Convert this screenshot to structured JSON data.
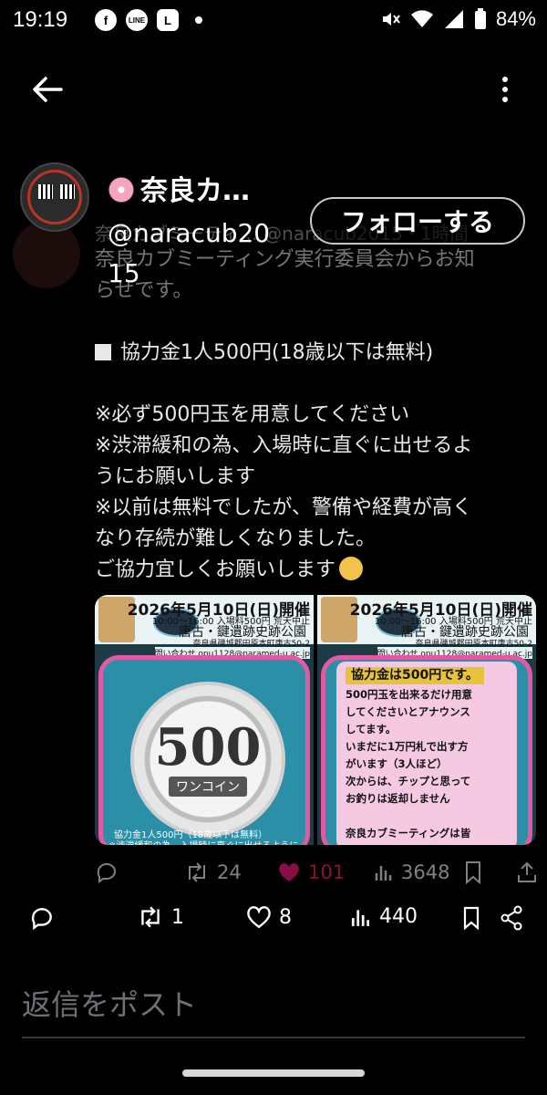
{
  "status_bar": {
    "time": "19:19",
    "battery": "84%",
    "app_icons": [
      "facebook-icon",
      "line-icon",
      "l-app-icon",
      "notification-dot"
    ],
    "icons": [
      "mute-icon",
      "wifi-icon",
      "signal-icon",
      "battery-icon"
    ],
    "line_label": "LINE",
    "l_label": "L",
    "fb_label": "f"
  },
  "app_bar": {
    "back_icon": "arrow-left-icon",
    "more_icon": "more-vertical-icon"
  },
  "profile": {
    "display_name": "奈良カ…",
    "handle": "@naracub2015",
    "follow_label": "フォローする"
  },
  "post": {
    "faded_header": "奈良カブミーティ… @naracub2015 · 1時間",
    "faded_line1": "奈良カブミーティング実行委員会からお知",
    "faded_line2": "らせです。",
    "fee_line": "協力金1人500円(18歳以下は無料)",
    "note1": "※必ず500円玉を用意してください",
    "note2a": "※渋滞緩和の為、入場時に直ぐに出せるよ",
    "note2b": "うにお願いします",
    "note3a": "※以前は無料でしたが、警備や経費が高く",
    "note3b": "なり存続が難しくなりました。",
    "closing": "ご協力宜しくお願いします"
  },
  "images": {
    "date": "2026年5月10日(日)開催",
    "time": "10:00〜16:00 入場料500円 荒天中止",
    "place": "唐古・鍵遺跡史跡公園",
    "address": "奈良県磯城郡田原本町唐古50-2",
    "contact": "問い合わせ opu1128@naramed-u.ac.jp",
    "coin_value": "500",
    "coin_label": "ワンコイン",
    "caption1": "協力金1人500円（18歳以下は無料）",
    "caption2": "※渋滞緩和の為、入場時に直ぐに出せるように",
    "notice_head": "協力金は500円です。",
    "notice_body": "500円玉を出来るだけ用意\nしてくださいとアナウンス\nしてます。\nいまだに1万円札で出す方\nがいます（3人ほど）\n次からは、チップと思って\nお釣りは返却しません\n\n奈良カブミーティングは皆\nさんの協力で成り立ってい\nますので、何卒宜しくお願"
  },
  "inner_actions": {
    "retweets": "24",
    "likes": "101",
    "views": "3648"
  },
  "main_actions": {
    "retweets": "1",
    "likes": "8",
    "views": "440"
  },
  "reply": {
    "placeholder": "返信をポスト"
  },
  "colors": {
    "background": "#000000",
    "like_pink": "#f91880",
    "text": "#e7e9ea",
    "muted": "#6e7175"
  }
}
